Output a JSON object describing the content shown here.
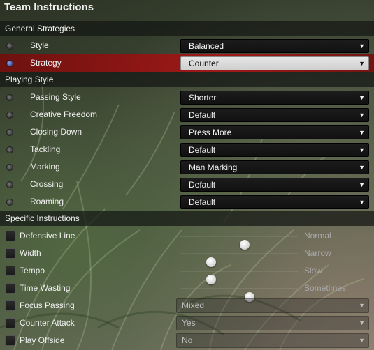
{
  "title": "Team Instructions",
  "sections": {
    "general": "General Strategies",
    "playing": "Playing Style",
    "specific": "Specific Instructions"
  },
  "general": [
    {
      "label": "Style",
      "value": "Balanced",
      "selected": false
    },
    {
      "label": "Strategy",
      "value": "Counter",
      "selected": true
    }
  ],
  "playing": [
    {
      "label": "Passing Style",
      "value": "Shorter"
    },
    {
      "label": "Creative Freedom",
      "value": "Default"
    },
    {
      "label": "Closing Down",
      "value": "Press More"
    },
    {
      "label": "Tackling",
      "value": "Default"
    },
    {
      "label": "Marking",
      "value": "Man Marking"
    },
    {
      "label": "Crossing",
      "value": "Default"
    },
    {
      "label": "Roaming",
      "value": "Default"
    }
  ],
  "specific_sliders": [
    {
      "label": "Defensive Line",
      "value": "Normal",
      "level": 0.55,
      "checked": false
    },
    {
      "label": "Width",
      "value": "Narrow",
      "level": 0.24,
      "checked": false
    },
    {
      "label": "Tempo",
      "value": "Slow",
      "level": 0.24,
      "checked": false
    },
    {
      "label": "Time Wasting",
      "value": "Sometimes",
      "level": 0.6,
      "checked": false
    }
  ],
  "specific_dropdowns": [
    {
      "label": "Focus Passing",
      "value": "Mixed",
      "checked": false
    },
    {
      "label": "Counter Attack",
      "value": "Yes",
      "checked": false
    },
    {
      "label": "Play Offside",
      "value": "No",
      "checked": false
    }
  ],
  "icons": {
    "dropdown_arrow": "chevron-down-icon",
    "radio": "radio-icon",
    "checkbox": "checkbox-icon"
  }
}
